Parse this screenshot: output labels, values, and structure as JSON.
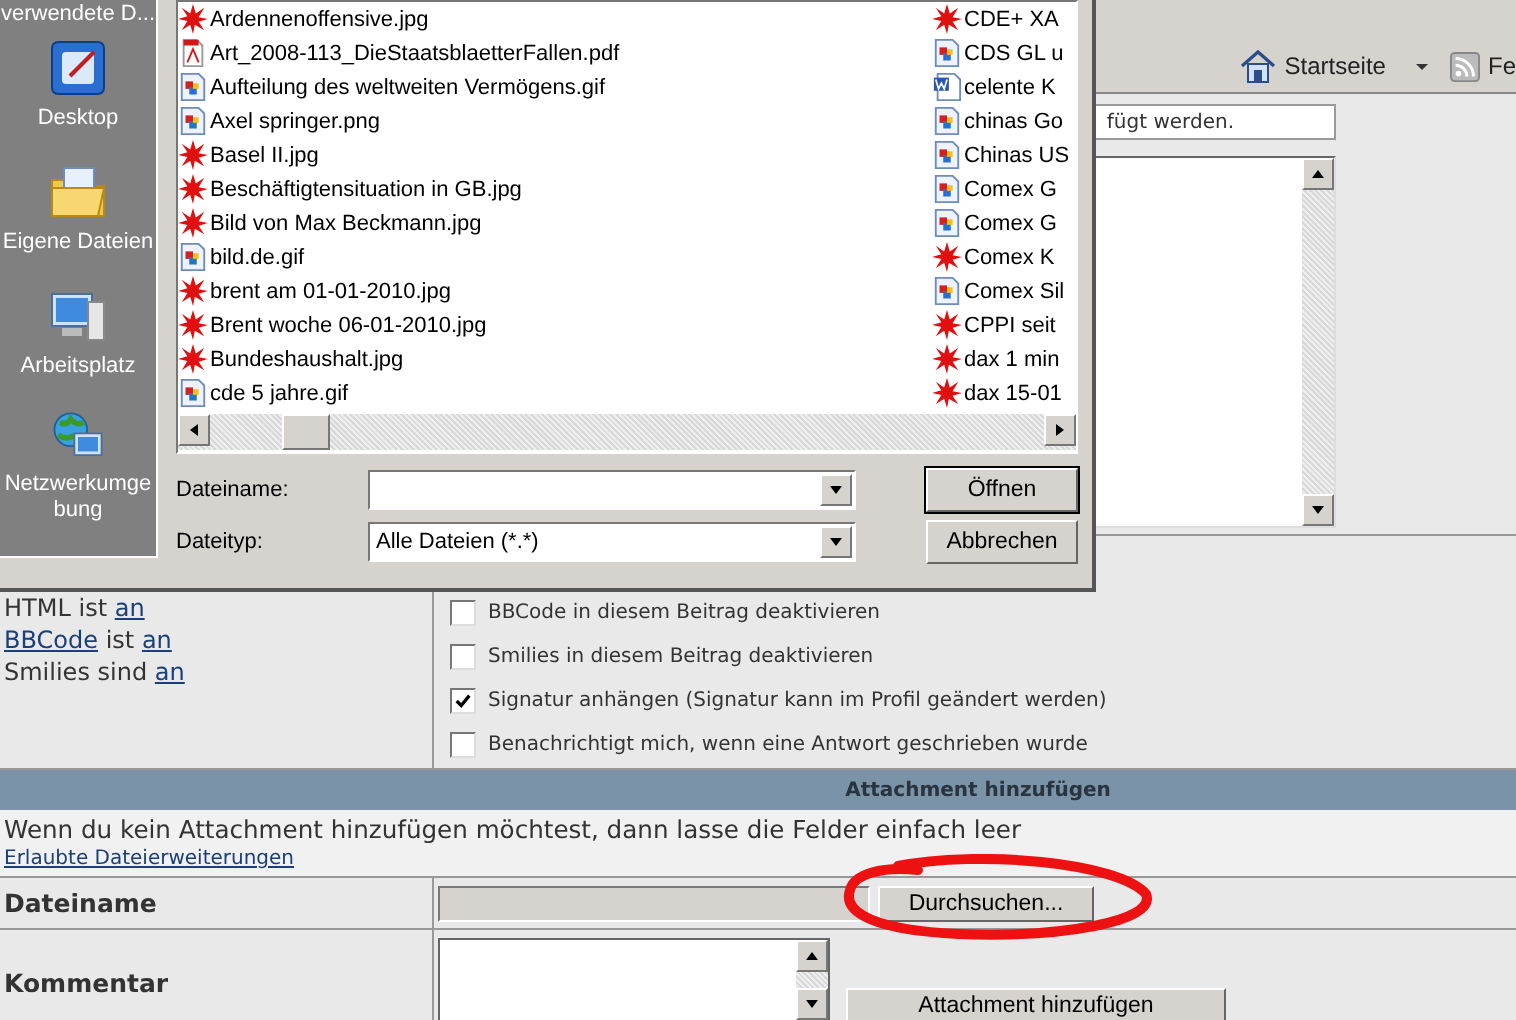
{
  "browser_toolbar": {
    "home_label": "Startseite",
    "feeds_label": "Fe"
  },
  "dialog": {
    "places_header": "verwendete D...",
    "places": [
      {
        "label": "Desktop",
        "kind": "desktop"
      },
      {
        "label": "Eigene Dateien",
        "kind": "documents"
      },
      {
        "label": "Arbeitsplatz",
        "kind": "computer"
      },
      {
        "label": "Netzwerkumgebung",
        "kind": "network"
      }
    ],
    "files": [
      {
        "name": "Ardennenoffensive.jpg",
        "kind": "broken"
      },
      {
        "name": "Art_2008-113_DieStaatsblaetterFallen.pdf",
        "kind": "pdf"
      },
      {
        "name": "Aufteilung des weltweiten Vermögens.gif",
        "kind": "image"
      },
      {
        "name": "Axel springer.png",
        "kind": "image"
      },
      {
        "name": "Basel II.jpg",
        "kind": "broken"
      },
      {
        "name": "Beschäftigtensituation in GB.jpg",
        "kind": "broken"
      },
      {
        "name": "Bild von Max Beckmann.jpg",
        "kind": "broken"
      },
      {
        "name": "bild.de.gif",
        "kind": "image"
      },
      {
        "name": "brent am 01-01-2010.jpg",
        "kind": "broken"
      },
      {
        "name": "Brent woche 06-01-2010.jpg",
        "kind": "broken"
      },
      {
        "name": "Bundeshaushalt.jpg",
        "kind": "broken"
      },
      {
        "name": "cde 5 jahre.gif",
        "kind": "image"
      }
    ],
    "files_column_2": [
      {
        "name": "CDE+ XA",
        "kind": "broken"
      },
      {
        "name": "CDS GL u",
        "kind": "image"
      },
      {
        "name": "celente K",
        "kind": "word"
      },
      {
        "name": "chinas Go",
        "kind": "image"
      },
      {
        "name": "Chinas US",
        "kind": "image"
      },
      {
        "name": "Comex G",
        "kind": "image"
      },
      {
        "name": "Comex G",
        "kind": "image"
      },
      {
        "name": "Comex K",
        "kind": "broken"
      },
      {
        "name": "Comex Sil",
        "kind": "image"
      },
      {
        "name": "CPPI seit",
        "kind": "broken"
      },
      {
        "name": "dax 1 min",
        "kind": "broken"
      },
      {
        "name": "dax 15-01",
        "kind": "broken"
      }
    ],
    "filename_label": "Dateiname:",
    "filetype_label": "Dateityp:",
    "filetype_value": "Alle Dateien (*.*)",
    "buttons": [
      "Öffnen",
      "Abbrechen"
    ]
  },
  "post_form": {
    "field_text": "fügt werden.",
    "status_lines": [
      [
        {
          "text": "HTML",
          "link": false
        },
        {
          "text": "ist",
          "link": false
        },
        {
          "text": "an",
          "link": true
        }
      ],
      [
        {
          "text": "BBCode",
          "link": true
        },
        {
          "text": "ist",
          "link": false
        },
        {
          "text": "an",
          "link": true
        }
      ],
      [
        {
          "text": "Smilies",
          "link": false
        },
        {
          "text": "sind",
          "link": false
        },
        {
          "text": "an",
          "link": true
        }
      ]
    ],
    "options": [
      {
        "label": "BBCode in diesem Beitrag deaktivieren",
        "checked": false
      },
      {
        "label": "Smilies in diesem Beitrag deaktivieren",
        "checked": false
      },
      {
        "label": "Signatur anhängen (Signatur kann im Profil geändert werden)",
        "checked": true
      },
      {
        "label": "Benachrichtigt mich, wenn eine Antwort geschrieben wurde",
        "checked": false
      }
    ]
  },
  "attachment": {
    "header": "Attachment hinzufügen",
    "hint": "Wenn du kein Attachment hinzufügen möchtest, dann lasse die Felder einfach leer",
    "link": "Erlaubte Dateierweiterungen",
    "filename_label": "Dateiname",
    "browse_button": "Durchsuchen...",
    "comment_label": "Kommentar",
    "add_button": "Attachment hinzufügen"
  }
}
